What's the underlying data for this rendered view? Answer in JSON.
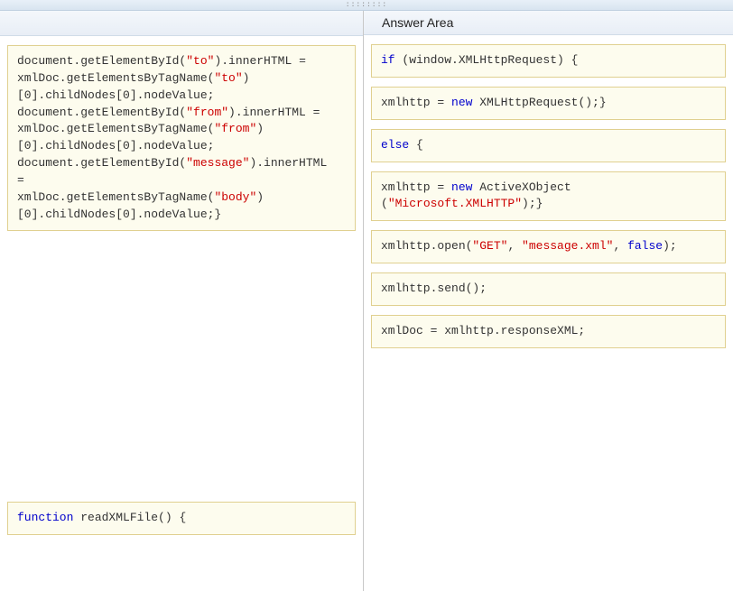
{
  "header": {
    "answer_area": "Answer Area"
  },
  "left": {
    "box1": {
      "tokens": [
        {
          "t": "document.getElementById("
        },
        {
          "t": "\"to\"",
          "cls": "kw-red"
        },
        {
          "t": ").innerHTML ="
        },
        {
          "t": "\n xmlDoc.getElementsByTagName("
        },
        {
          "t": "\"to\"",
          "cls": "kw-red"
        },
        {
          "t": ")"
        },
        {
          "t": "\n[0].childNodes[0].nodeValue;"
        },
        {
          "t": "\ndocument.getElementById("
        },
        {
          "t": "\"from\"",
          "cls": "kw-red"
        },
        {
          "t": ").innerHTML ="
        },
        {
          "t": "\n xmlDoc.getElementsByTagName("
        },
        {
          "t": "\"from\"",
          "cls": "kw-red"
        },
        {
          "t": ")"
        },
        {
          "t": "\n[0].childNodes[0].nodeValue;"
        },
        {
          "t": "\ndocument.getElementById("
        },
        {
          "t": "\"message\"",
          "cls": "kw-red"
        },
        {
          "t": ").innerHTML"
        },
        {
          "t": "\n="
        },
        {
          "t": "\n xmlDoc.getElementsByTagName("
        },
        {
          "t": "\"body\"",
          "cls": "kw-red"
        },
        {
          "t": ")"
        },
        {
          "t": "\n[0].childNodes[0].nodeValue;}"
        }
      ]
    },
    "box2": {
      "tokens": [
        {
          "t": "function",
          "cls": "kw-blue"
        },
        {
          "t": " readXMLFile() {"
        }
      ]
    }
  },
  "right": {
    "box1": {
      "tokens": [
        {
          "t": "if",
          "cls": "kw-blue"
        },
        {
          "t": " (window.XMLHttpRequest) {"
        }
      ]
    },
    "box2": {
      "tokens": [
        {
          "t": "xmlhttp = "
        },
        {
          "t": "new",
          "cls": "kw-blue"
        },
        {
          "t": " XMLHttpRequest();}"
        }
      ]
    },
    "box3": {
      "tokens": [
        {
          "t": "else",
          "cls": "kw-blue"
        },
        {
          "t": " {"
        }
      ]
    },
    "box4": {
      "tokens": [
        {
          "t": "xmlhttp = "
        },
        {
          "t": "new",
          "cls": "kw-blue"
        },
        {
          "t": " ActiveXObject"
        },
        {
          "t": "\n("
        },
        {
          "t": "\"Microsoft.XMLHTTP\"",
          "cls": "kw-red"
        },
        {
          "t": ");}"
        }
      ]
    },
    "box5": {
      "tokens": [
        {
          "t": "xmlhttp.open("
        },
        {
          "t": "\"GET\"",
          "cls": "kw-red"
        },
        {
          "t": ", "
        },
        {
          "t": "\"message.xml\"",
          "cls": "kw-red"
        },
        {
          "t": ", "
        },
        {
          "t": "false",
          "cls": "kw-blue"
        },
        {
          "t": ");"
        }
      ]
    },
    "box6": {
      "tokens": [
        {
          "t": "xmlhttp.send();"
        }
      ]
    },
    "box7": {
      "tokens": [
        {
          "t": "xmlDoc = xmlhttp.responseXML;"
        }
      ]
    }
  }
}
